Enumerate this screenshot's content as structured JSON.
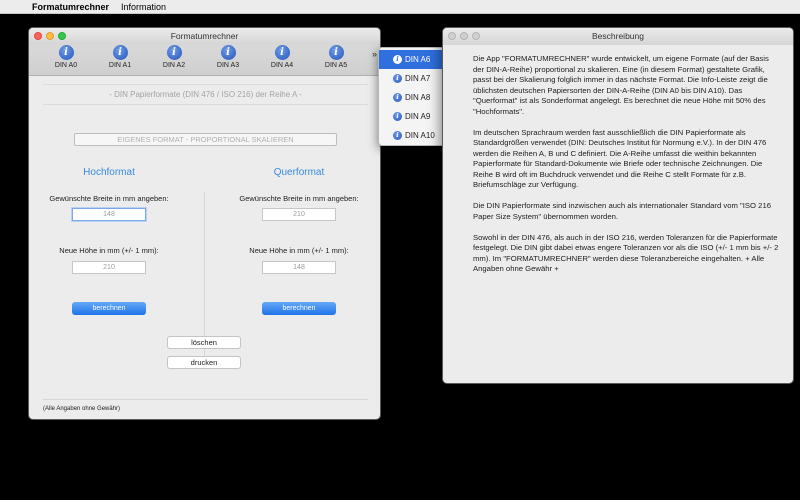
{
  "menubar": {
    "app_name": "Formatumrechner",
    "menu_info": "Information"
  },
  "main_window": {
    "title": "Formatumrechner",
    "toolbar": [
      "DIN A0",
      "DIN A1",
      "DIN A2",
      "DIN A3",
      "DIN A4",
      "DIN A5"
    ],
    "overflow": "»",
    "section_title": "- DIN Papierformate (DIN 476 / ISO 216) der Reihe A -",
    "custom_button": "EIGENES FORMAT - PROPORTIONAL SKALIEREN",
    "hoch": {
      "heading": "Hochformat",
      "width_label": "Gewünschte Breite in mm angeben:",
      "width_value": "148",
      "height_label": "Neue Höhe in mm (+/- 1 mm):",
      "height_value": "210",
      "button": "berechnen"
    },
    "quer": {
      "heading": "Querformat",
      "width_label": "Gewünschte Breite in mm angeben:",
      "width_value": "210",
      "height_label": "Neue Höhe in mm (+/- 1 mm):",
      "height_value": "148",
      "button": "berechnen"
    },
    "clear_button": "löschen",
    "print_button": "drucken",
    "footer_note": "(Alle Angaben ohne Gewähr)"
  },
  "dropdown": {
    "items": [
      "DIN A6",
      "DIN A7",
      "DIN A8",
      "DIN A9",
      "DIN A10"
    ],
    "selected": "DIN A6"
  },
  "description_window": {
    "title": "Beschreibung",
    "paragraphs": [
      "Die App \"FORMATUMRECHNER\" wurde entwickelt, um eigene Formate (auf der Basis der DIN-A-Reihe) proportional zu skalieren. Eine (in diesem Format) gestaltete Grafik, passt bei der Skalierung folglich immer in das nächste Format. Die Info-Leiste zeigt die üblichsten deutschen Papiersorten der DIN-A-Reihe (DIN A0 bis DIN A10). Das \"Querformat\" ist als Sonderformat angelegt. Es berechnet die neue Höhe mit 50% des \"Hochformats\".",
      "Im deutschen Sprachraum werden fast ausschließlich die DIN Papierformate als Standardgrößen verwendet (DIN: Deutsches Institut für Normung e.V.). In der DIN 476 werden die Reihen A, B und C definiert. Die A-Reihe umfasst die weithin bekannten Papierformate für Standard-Dokumente wie Briefe oder technische Zeichnungen. Die Reihe B wird oft im Buchdruck verwendet und die Reihe C stellt Formate für z.B. Briefumschläge zur Verfügung.",
      "Die DIN Papierformate sind inzwischen auch als internationaler Standard vom \"ISO 216 Paper Size System\" übernommen worden.",
      "Sowohl in der DIN 476, als auch in der ISO 216, werden Toleranzen für die Papierformate festgelegt. Die DIN gibt dabei etwas engere Toleranzen vor als die ISO (+/- 1 mm bis +/- 2 mm). Im \"FORMATUMRECHNER\" werden diese Toleranzbereiche eingehalten. + Alle Angaben ohne Gewähr +"
    ]
  }
}
